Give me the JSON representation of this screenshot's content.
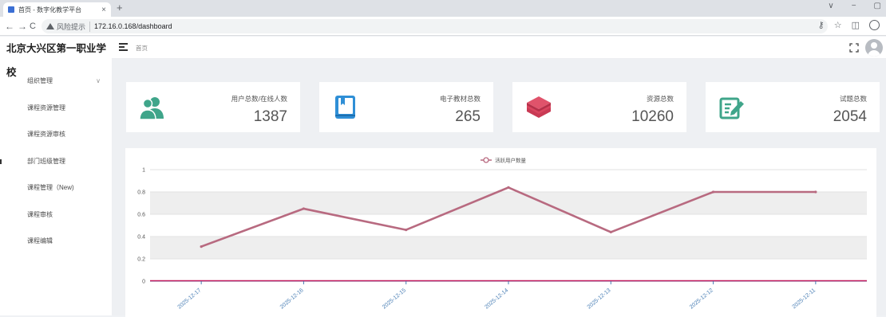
{
  "browser": {
    "tab_title": "首页 - 数字化教学平台",
    "tab_close": "×",
    "new_tab": "+",
    "window_controls": [
      "∨",
      "−",
      "▢"
    ],
    "nav_back": "←",
    "nav_forward": "→",
    "nav_reload": "C",
    "security_warning": "风险提示",
    "url": "172.16.0.168/dashboard",
    "right_controls": [
      "⚷",
      "☆",
      "◫"
    ]
  },
  "sidebar": {
    "brand": "北京大兴区第一职业学校",
    "items": [
      {
        "label": "组织管理",
        "chevron": "∨"
      },
      {
        "label": "课程资源管理"
      },
      {
        "label": "课程资源审核"
      },
      {
        "label": "部门班级管理"
      },
      {
        "label": "课程管理（New)"
      },
      {
        "label": "课程审核"
      },
      {
        "label": "课程编辑"
      }
    ]
  },
  "header": {
    "breadcrumb": "首页"
  },
  "cards": [
    {
      "label": "用户总数/在线人数",
      "value": "1387",
      "icon": "users-icon",
      "color": "#3fa58a"
    },
    {
      "label": "电子教材总数",
      "value": "265",
      "icon": "book-icon",
      "color": "#2f8fd6"
    },
    {
      "label": "资源总数",
      "value": "10260",
      "icon": "layers-icon",
      "color": "#e0536b"
    },
    {
      "label": "试题总数",
      "value": "2054",
      "icon": "edit-icon",
      "color": "#3fa58a"
    }
  ],
  "chart_data": {
    "type": "line",
    "title": "",
    "xlabel": "",
    "ylabel": "",
    "categories": [
      "2025-12-17",
      "2025-12-16",
      "2025-12-15",
      "2025-12-14",
      "2025-12-13",
      "2025-12-12",
      "2025-12-11"
    ],
    "series": [
      {
        "name": "活跃用户数量",
        "values": [
          0.31,
          0.65,
          0.46,
          0.84,
          0.44,
          0.8,
          0.8
        ],
        "color": "#b86a80"
      }
    ],
    "baseline_color": "#c2185b",
    "ylim": [
      0,
      1
    ],
    "yticks": [
      "0",
      "0.2",
      "0.4",
      "0.6",
      "0.8",
      "1"
    ],
    "grid": "banded",
    "legend_position": "top-center",
    "axis_color": "#4a7fb5"
  }
}
